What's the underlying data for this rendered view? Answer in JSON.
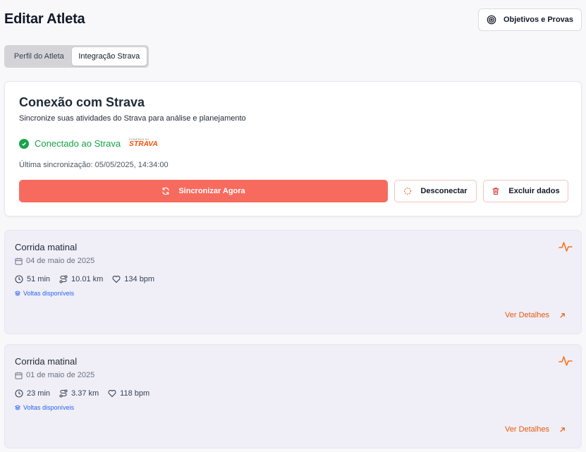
{
  "page": {
    "title": "Editar Atleta"
  },
  "header": {
    "goals_button": "Objetivos e Provas"
  },
  "tabs": [
    {
      "label": "Perfil do Atleta",
      "active": false
    },
    {
      "label": "Integração Strava",
      "active": true
    }
  ],
  "strava": {
    "title": "Conexão com Strava",
    "subtitle": "Sincronize suas atividades do Strava para análise e planejamento",
    "status": "Conectado ao Strava",
    "logo_small": "POWERED BY",
    "logo_name": "STRAVA",
    "last_sync": "Última sincronização: 05/05/2025, 14:34:00",
    "sync_button": "Sincronizar Agora",
    "disconnect_button": "Desconectar",
    "delete_button": "Excluir dados"
  },
  "activities": [
    {
      "name": "Corrida matinal",
      "date": "04 de maio de 2025",
      "duration": "51 min",
      "distance": "10.01 km",
      "heart_rate": "134 bpm",
      "laps": "Voltas disponíveis",
      "details": "Ver Detalhes"
    },
    {
      "name": "Corrida matinal",
      "date": "01 de maio de 2025",
      "duration": "23 min",
      "distance": "3.37 km",
      "heart_rate": "118 bpm",
      "laps": "Voltas disponíveis",
      "details": "Ver Detalhes"
    }
  ],
  "colors": {
    "accent": "#f76b5e",
    "success": "#16a34a",
    "strava": "#fc4c02",
    "link": "#ea580c",
    "laps": "#2563eb"
  }
}
